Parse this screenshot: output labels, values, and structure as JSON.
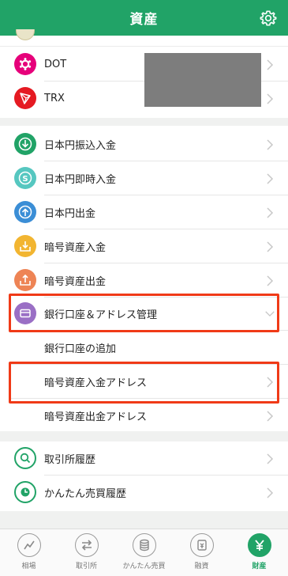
{
  "header": {
    "title": "資産",
    "settings_icon": "gear-icon"
  },
  "crypto_list": [
    {
      "name": "DOT",
      "icon": "polkadot-icon",
      "color": "#e6007a"
    },
    {
      "name": "TRX",
      "icon": "tron-icon",
      "color": "#e51a22"
    }
  ],
  "menu": {
    "items": [
      {
        "label": "日本円振込入金",
        "icon": "download-icon",
        "color": "#21a367"
      },
      {
        "label": "日本円即時入金",
        "icon": "yen-coin-icon",
        "color": "#56c7c0"
      },
      {
        "label": "日本円出金",
        "icon": "upload-icon",
        "color": "#3b8ed6"
      },
      {
        "label": "暗号資産入金",
        "icon": "crypto-deposit-icon",
        "color": "#f2b531"
      },
      {
        "label": "暗号資産出金",
        "icon": "crypto-withdraw-icon",
        "color": "#ee8455"
      },
      {
        "label": "銀行口座＆アドレス管理",
        "icon": "wallet-icon",
        "color": "#9a6fc5"
      }
    ],
    "sub_items": [
      {
        "label": "銀行口座の追加"
      },
      {
        "label": "暗号資産入金アドレス"
      },
      {
        "label": "暗号資産出金アドレス"
      }
    ]
  },
  "history": {
    "items": [
      {
        "label": "取引所履歴",
        "icon": "search-icon"
      },
      {
        "label": "かんたん売買履歴",
        "icon": "clock-icon"
      }
    ]
  },
  "tabs": [
    {
      "label": "相場",
      "icon": "chart-line-icon",
      "active": false
    },
    {
      "label": "取引所",
      "icon": "exchange-arrows-icon",
      "active": false
    },
    {
      "label": "かんたん売買",
      "icon": "coin-stack-icon",
      "active": false
    },
    {
      "label": "融資",
      "icon": "lending-icon",
      "active": false
    },
    {
      "label": "財産",
      "icon": "yen-icon",
      "active": true
    }
  ],
  "colors": {
    "brand": "#21a367",
    "highlight": "#f03a17"
  }
}
